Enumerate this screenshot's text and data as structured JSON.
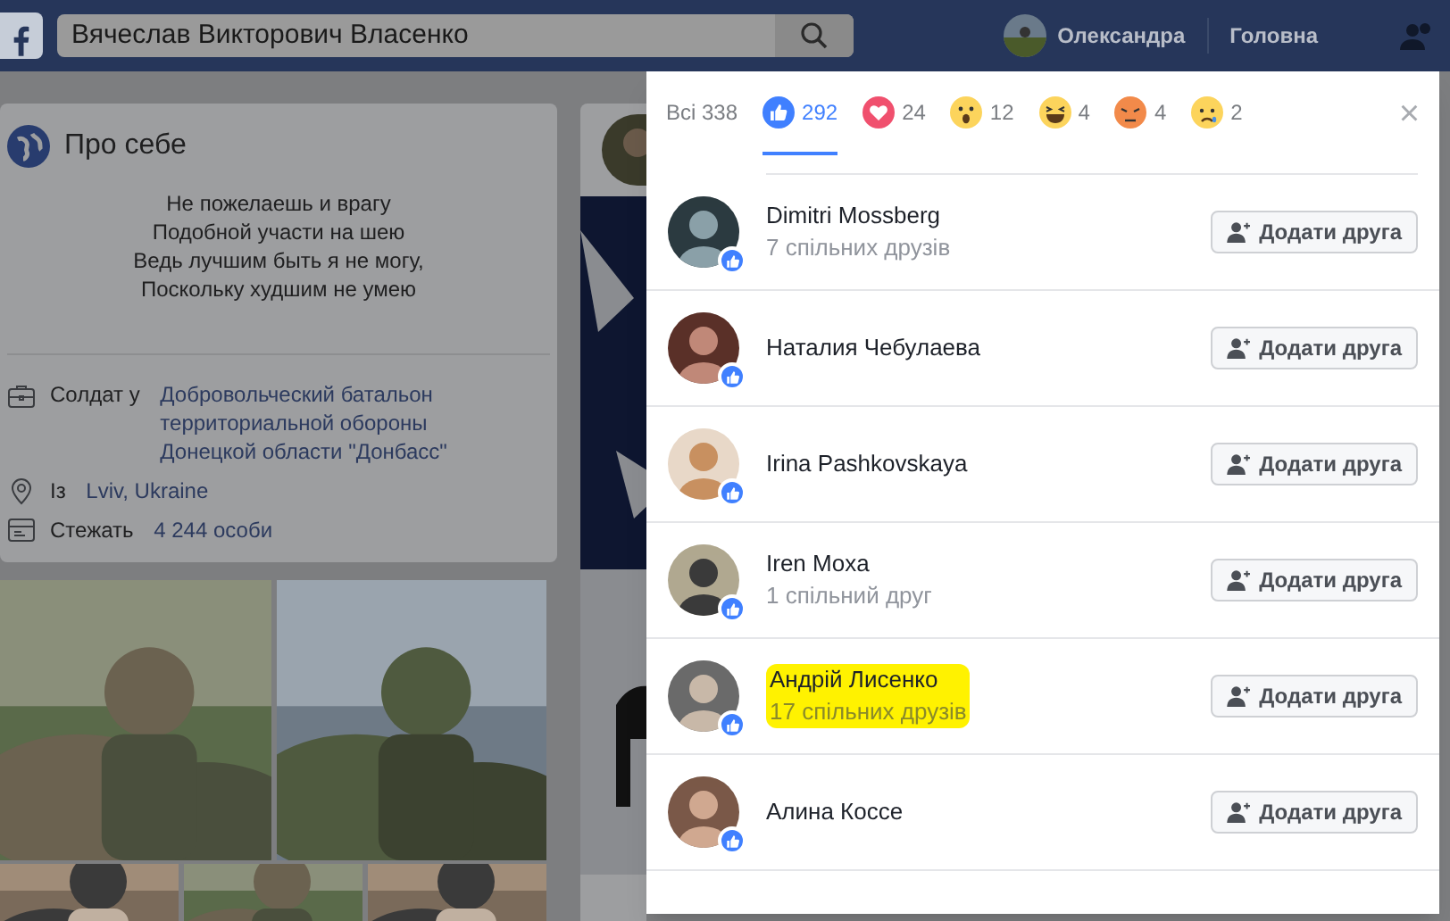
{
  "header": {
    "search_value": "Вячеслав Викторович Власенко",
    "user_name": "Олександра",
    "home": "Головна"
  },
  "about": {
    "title": "Про себе",
    "quote": [
      "Не пожелаешь и врагу",
      "Подобной участи на шею",
      "Ведь лучшим быть я не могу,",
      "Поскольку худшим не умею"
    ],
    "facts": [
      {
        "kind": "work",
        "text": "Солдат у ",
        "link": "Добровольческий батальон территориальной обороны Донецкой области \"Донбасс\""
      },
      {
        "kind": "place",
        "text": "Із ",
        "link": "Lviv, Ukraine"
      },
      {
        "kind": "followers",
        "text": "Стежать ",
        "link": "4 244 особи"
      }
    ]
  },
  "reactions": {
    "tabs": [
      {
        "kind": "all",
        "label": "Всі 338",
        "selected": false
      },
      {
        "kind": "like",
        "label": "292",
        "selected": true
      },
      {
        "kind": "love",
        "label": "24",
        "selected": false
      },
      {
        "kind": "wow",
        "label": "12",
        "selected": false
      },
      {
        "kind": "haha",
        "label": "4",
        "selected": false
      },
      {
        "kind": "angry",
        "label": "4",
        "selected": false
      },
      {
        "kind": "sad",
        "label": "2",
        "selected": false
      }
    ],
    "close": "×",
    "people": [
      {
        "name": "Dimitri Mossberg",
        "mutual": "7 спільних друзів",
        "highlighted": false,
        "button": "Додати друга"
      },
      {
        "name": "Наталия Чебулаева",
        "highlighted": false,
        "button": "Додати друга"
      },
      {
        "name": "Irina Pashkovskaya",
        "highlighted": false,
        "button": "Додати друга"
      },
      {
        "name": "Iren Moxa",
        "mutual": "1 спільний друг",
        "highlighted": false,
        "button": "Додати друга"
      },
      {
        "name": "Андрій Лисенко",
        "mutual": "17 спільних друзів",
        "highlighted": true,
        "button": "Додати друга"
      },
      {
        "name": "Алина Коссе",
        "highlighted": false,
        "button": "Додати друга"
      }
    ]
  }
}
